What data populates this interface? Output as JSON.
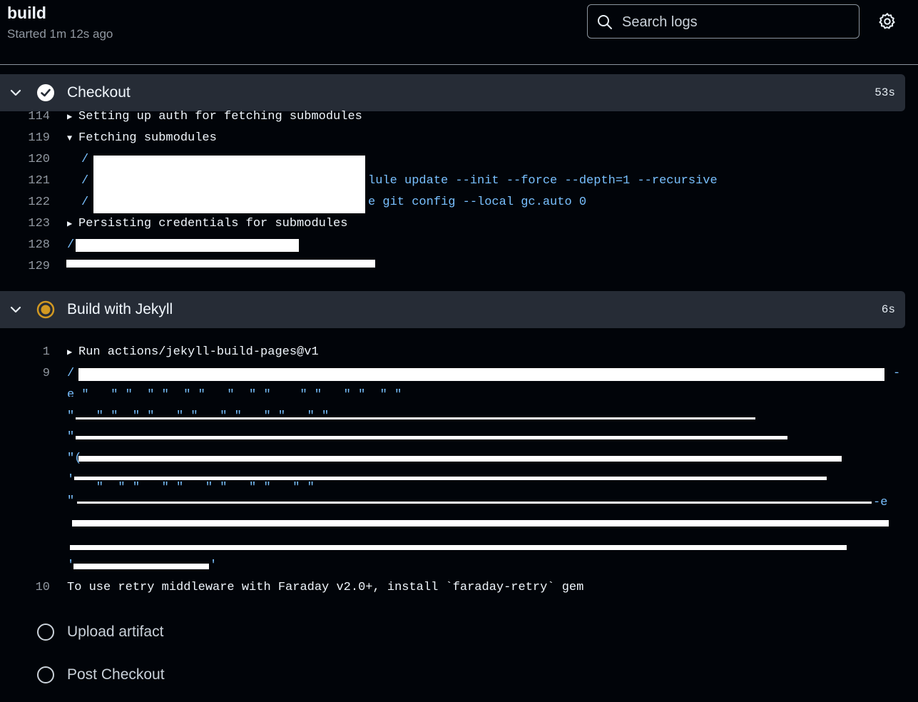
{
  "header": {
    "title": "build",
    "status": "Started 1m 12s ago",
    "search_placeholder": "Search logs"
  },
  "steps": [
    {
      "name": "Checkout",
      "duration": "53s",
      "state": "success",
      "lines": [
        {
          "num": "114",
          "text": "Setting up auth for fetching submodules",
          "marker": "▶"
        },
        {
          "num": "119",
          "text": "Fetching submodules",
          "marker": "▼"
        },
        {
          "num": "120",
          "text": "/"
        },
        {
          "num": "121",
          "text": "/",
          "tail": "lule update --init --force --depth=1 --recursive"
        },
        {
          "num": "122",
          "text": "/",
          "tail": "e git config --local gc.auto 0"
        },
        {
          "num": "123",
          "text": "Persisting credentials for submodules",
          "marker": "▶"
        },
        {
          "num": "128",
          "text": "/"
        },
        {
          "num": "129",
          "text": ""
        }
      ]
    },
    {
      "name": "Build with Jekyll",
      "duration": "6s",
      "state": "in_progress",
      "lines": [
        {
          "num": "1",
          "text": "Run actions/jekyll-build-pages@v1",
          "marker": "▶"
        },
        {
          "num": "9",
          "text": "/",
          "tail": "-"
        },
        {
          "num": "10",
          "text": "To use retry middleware with Faraday v2.0+, install `faraday-retry` gem"
        }
      ],
      "wrapped_tail": "-e"
    },
    {
      "name": "Upload artifact",
      "state": "pending"
    },
    {
      "name": "Post Checkout",
      "state": "pending"
    }
  ],
  "colors": {
    "background": "#010409",
    "step_header": "#262c36",
    "success": "#ffffff",
    "in_progress": "#d29922",
    "log_blue": "#79c0ff"
  }
}
